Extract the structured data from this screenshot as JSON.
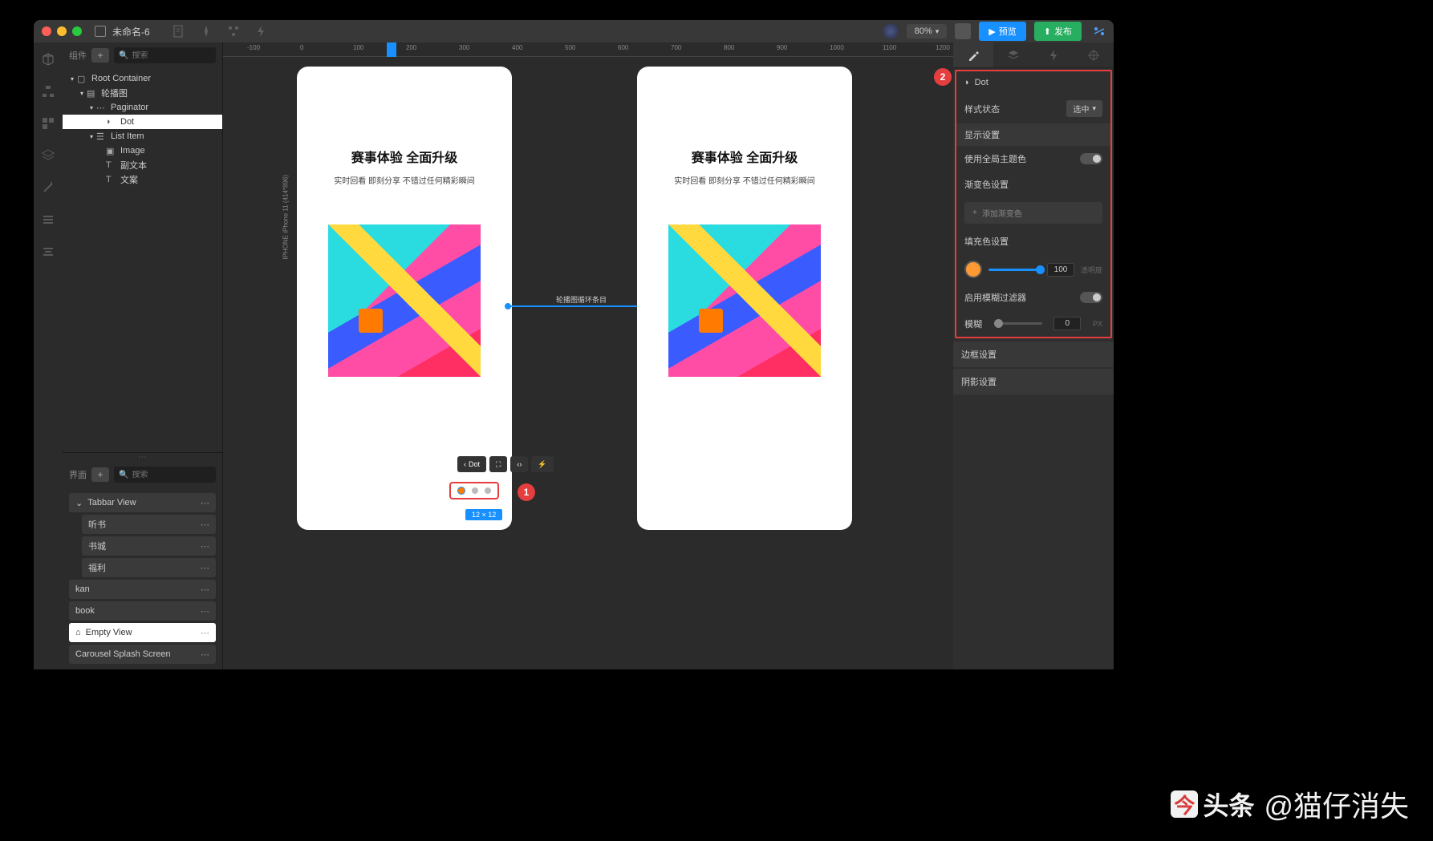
{
  "window": {
    "title": "未命名-6",
    "zoom": "80%",
    "preview_btn": "预览",
    "publish_btn": "发布"
  },
  "left_panel": {
    "components_label": "组件",
    "search_placeholder": "搜索",
    "tree": {
      "root": "Root Container",
      "carousel": "轮播图",
      "paginator": "Paginator",
      "dot": "Dot",
      "list_item": "List Item",
      "image": "Image",
      "subtext": "副文本",
      "text": "文案"
    },
    "pages_label": "界面",
    "pages": {
      "tabbar": "Tabbar View",
      "p1": "听书",
      "p2": "书城",
      "p3": "福利",
      "kan": "kan",
      "book": "book",
      "empty": "Empty View",
      "carousel_splash": "Carousel Splash Screen"
    }
  },
  "canvas": {
    "artboard_label": "IPHONE   iPhone 11 (414*896)",
    "headline": "赛事体验 全面升级",
    "subline": "实时回看 即刻分享 不错过任何精彩瞬间",
    "connection_label": "轮播图循环条目",
    "toolbar_dot": "Dot",
    "size_label": "12 × 12",
    "ruler_ticks": [
      "-100",
      "0",
      "100",
      "200",
      "300",
      "400",
      "500",
      "600",
      "700",
      "800",
      "900",
      "1000",
      "1100",
      "1200"
    ]
  },
  "inspector": {
    "title": "Dot",
    "style_state_label": "样式状态",
    "style_state_value": "选中",
    "display_section": "显示设置",
    "global_theme": "使用全局主题色",
    "gradient_section": "渐变色设置",
    "add_gradient": "添加渐变色",
    "fill_section": "填充色设置",
    "opacity_value": "100",
    "opacity_label": "透明度",
    "blur_filter": "启用模糊过滤器",
    "blur_label": "模糊",
    "blur_value": "0",
    "blur_unit": "PX",
    "border_section": "边框设置",
    "shadow_section": "阴影设置",
    "fill_color": "#ff9933"
  },
  "callouts": {
    "one": "1",
    "two": "2"
  },
  "watermark": {
    "logo": "头条",
    "author": "@猫仔消失"
  }
}
